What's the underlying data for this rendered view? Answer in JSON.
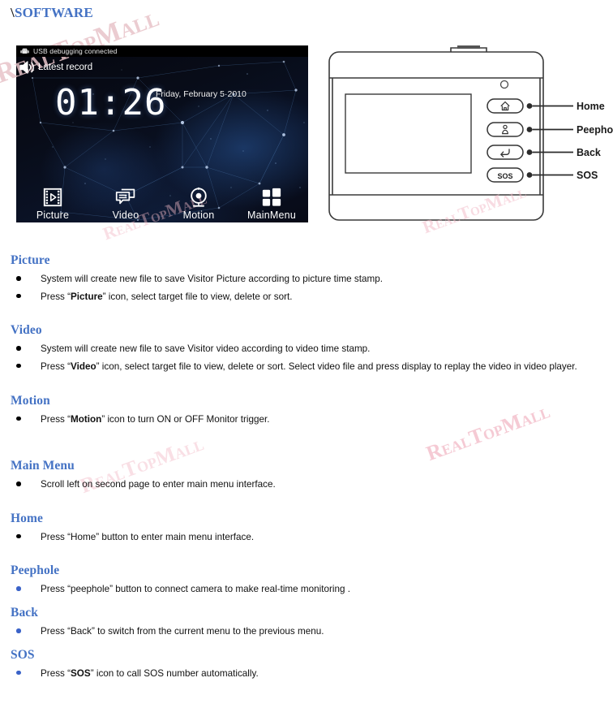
{
  "page": {
    "title_prefix": "\\",
    "title": "SOFTWARE",
    "watermark": "RealTopMall"
  },
  "device_screen": {
    "statusbar": {
      "icon": "android-bug-icon",
      "text": "USB debugging connected"
    },
    "notification": {
      "icon": "speaker-icon",
      "text": "Latest record"
    },
    "clock": "01:26",
    "date": "Friday, February 5·2010",
    "dock": [
      {
        "label": "Picture",
        "icon": "film-strip-icon"
      },
      {
        "label": "Video",
        "icon": "speech-bubble-icon"
      },
      {
        "label": "Motion",
        "icon": "webcam-icon"
      },
      {
        "label": "MainMenu",
        "icon": "grid-four-squares-icon"
      }
    ]
  },
  "device_diagram": {
    "buttons": [
      {
        "glyph": "home-icon",
        "label": "Home"
      },
      {
        "glyph": "peephole-icon",
        "label": "Peephole"
      },
      {
        "glyph": "back-arrow-icon",
        "label": "Back"
      },
      {
        "glyph": "SOS",
        "label": "SOS"
      }
    ]
  },
  "sections": [
    {
      "heading": "Picture",
      "bullets": [
        {
          "color": "black",
          "parts": [
            {
              "t": "System will create new file to save Visitor Picture according to picture time stamp."
            }
          ]
        },
        {
          "color": "black",
          "parts": [
            {
              "t": "Press  “"
            },
            {
              "t": "Picture",
              "b": true
            },
            {
              "t": "”  icon, select target file to view, delete or sort."
            }
          ]
        }
      ]
    },
    {
      "heading": "Video",
      "bullets": [
        {
          "color": "black",
          "parts": [
            {
              "t": "System will create new file to save Visitor video according to video time stamp."
            }
          ]
        },
        {
          "color": "black",
          "parts": [
            {
              "t": "Press  “"
            },
            {
              "t": "Video",
              "b": true
            },
            {
              "t": "”  icon, select target file to view, delete or sort. Select video file and press display to replay the video in video player."
            }
          ]
        }
      ]
    },
    {
      "heading": "Motion",
      "bullets": [
        {
          "color": "black",
          "parts": [
            {
              "t": "Press  “"
            },
            {
              "t": "Motion",
              "b": true
            },
            {
              "t": "”  icon to turn ON or OFF Monitor trigger."
            }
          ]
        }
      ]
    },
    {
      "heading": "Main Menu",
      "bullets": [
        {
          "color": "black",
          "parts": [
            {
              "t": "Scroll left on second page to enter main menu interface."
            }
          ]
        }
      ]
    },
    {
      "heading": "Home",
      "bullets": [
        {
          "color": "black",
          "parts": [
            {
              "t": "Press “Home” button to enter main menu interface."
            }
          ]
        }
      ]
    },
    {
      "heading": "Peephole",
      "bullets": [
        {
          "color": "blue",
          "parts": [
            {
              "t": "Press “peephole” button to connect camera to make real-time monitoring ."
            }
          ]
        }
      ]
    },
    {
      "heading": "Back",
      "bullets": [
        {
          "color": "blue",
          "parts": [
            {
              "t": "Press “Back” to switch from the current menu to the previous menu."
            }
          ]
        }
      ]
    },
    {
      "heading": "SOS",
      "bullets": [
        {
          "color": "blue",
          "parts": [
            {
              "t": "Press  “"
            },
            {
              "t": "SOS",
              "b": true
            },
            {
              "t": "”  icon to call SOS number automatically."
            }
          ]
        }
      ]
    }
  ],
  "colors": {
    "heading_blue": "#4472C4",
    "bullet_blue": "#3A62C8",
    "watermark_pink": "#f2b9c6"
  }
}
